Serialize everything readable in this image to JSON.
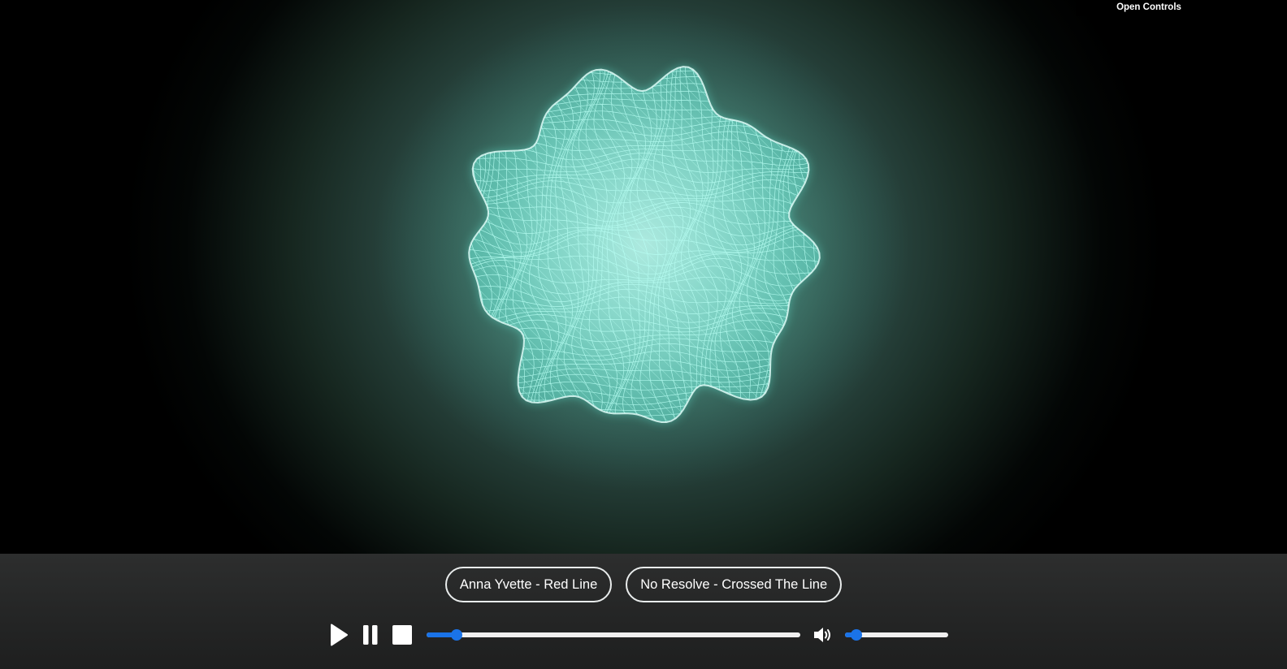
{
  "visualizer": {
    "accent_color": "#b8fff4",
    "glow_color": "#5fe0cc",
    "background_center": "#4d7a6f",
    "background_edge": "#000000",
    "open_controls_label": "Open Controls"
  },
  "tracks": [
    {
      "label": "Anna Yvette - Red Line"
    },
    {
      "label": "No Resolve - Crossed The Line"
    }
  ],
  "player": {
    "icons": {
      "play": "play-icon",
      "pause": "pause-icon",
      "stop": "stop-icon",
      "volume": "volume-icon"
    },
    "progress_fraction": 0.08,
    "volume_fraction": 0.11,
    "slider_color": "#1a73e8",
    "track_color": "#f0f0f0"
  }
}
